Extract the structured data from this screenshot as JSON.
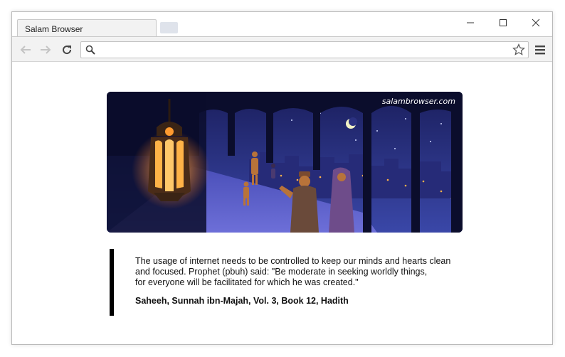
{
  "browser": {
    "tab_title": "Salam Browser",
    "address_value": "",
    "address_placeholder": ""
  },
  "banner": {
    "watermark": "salambrowser.com"
  },
  "quote": {
    "lines": [
      "The usage of internet needs to be controlled to keep our minds and hearts clean",
      "and focused. Prophet (pbuh) said: \"Be moderate in seeking worldly things,",
      "for everyone will be facilitated for which he was created.\""
    ],
    "source": "Saheeh, Sunnah ibn-Majah, Vol. 3, Book 12, Hadith"
  },
  "colors": {
    "accent": "#000000",
    "toolbar_bg": "#f2f2f2",
    "night_sky": "#1e2470"
  }
}
